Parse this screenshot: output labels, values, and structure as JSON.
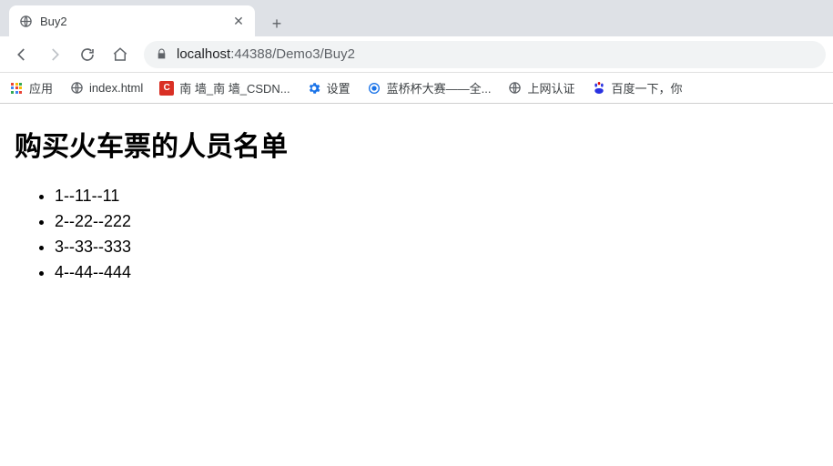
{
  "tab": {
    "title": "Buy2"
  },
  "url": {
    "host": "localhost",
    "port": ":44388",
    "path": "/Demo3/Buy2"
  },
  "bookmarks": [
    {
      "label": "应用",
      "icon": "apps"
    },
    {
      "label": "index.html",
      "icon": "globe"
    },
    {
      "label": "南 墙_南 墙_CSDN...",
      "icon": "csdn"
    },
    {
      "label": "设置",
      "icon": "gear"
    },
    {
      "label": "蓝桥杯大赛——全...",
      "icon": "lq"
    },
    {
      "label": "上网认证",
      "icon": "globe"
    },
    {
      "label": "百度一下，你",
      "icon": "baidu"
    }
  ],
  "page": {
    "heading": "购买火车票的人员名单",
    "items": [
      "1--11--11",
      "2--22--222",
      "3--33--333",
      "4--44--444"
    ]
  }
}
